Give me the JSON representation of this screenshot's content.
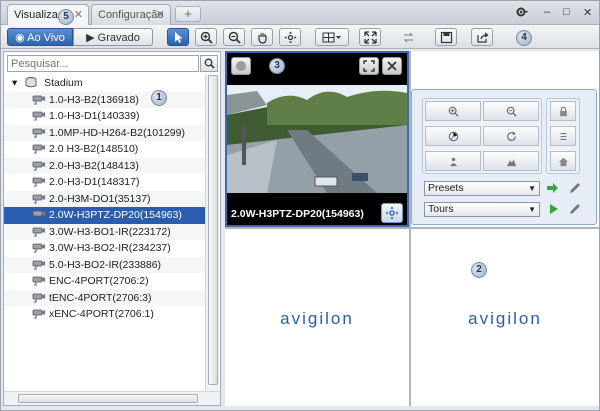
{
  "tabs": [
    {
      "label": "Visualizaç"
    },
    {
      "label": "Configuração"
    }
  ],
  "toolbar": {
    "live_label": "Ao Vivo",
    "recorded_label": "Gravado"
  },
  "search": {
    "placeholder": "Pesquisar..."
  },
  "tree": {
    "root_label": "Stadium",
    "items": [
      {
        "label": "1.0-H3-B2(136918)"
      },
      {
        "label": "1.0-H3-D1(140339)"
      },
      {
        "label": "1.0MP-HD-H264-B2(101299)"
      },
      {
        "label": "2.0 H3-B2(148510)"
      },
      {
        "label": "2.0-H3-B2(148413)"
      },
      {
        "label": "2.0-H3-D1(148317)"
      },
      {
        "label": "2.0-H3M-DO1(35137)"
      },
      {
        "label": "2.0W-H3PTZ-DP20(154963)"
      },
      {
        "label": "3.0W-H3-BO1-IR(223172)"
      },
      {
        "label": "3.0W-H3-BO2-IR(234237)"
      },
      {
        "label": "5.0-H3-BO2-IR(233886)"
      },
      {
        "label": "ENC-4PORT(2706:2)"
      },
      {
        "label": "tENC-4PORT(2706:3)"
      },
      {
        "label": "xENC-4PORT(2706:1)"
      }
    ]
  },
  "video": {
    "camera_label": "2.0W-H3PTZ-DP20(154963)",
    "logo_text": "avigilon"
  },
  "ptz": {
    "presets_label": "Presets",
    "tours_label": "Tours"
  },
  "callouts": [
    "1",
    "2",
    "3",
    "4",
    "5"
  ],
  "colors": {
    "accent": "#2a5db0",
    "logo": "#2a5eaa"
  }
}
